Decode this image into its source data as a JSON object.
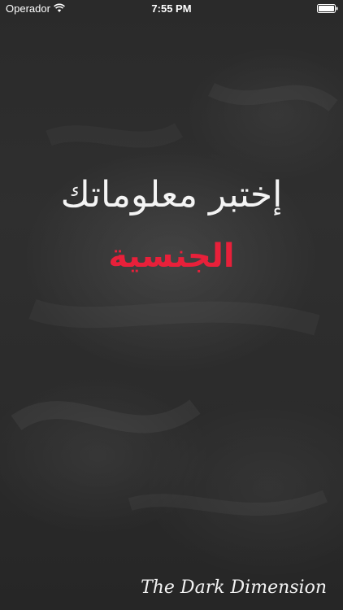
{
  "status_bar": {
    "carrier": "Operador",
    "time": "7:55 PM",
    "wifi_icon": "wifi-icon",
    "battery_icon": "battery-full-icon"
  },
  "screen": {
    "headline": "إختبر معلوماتك",
    "subheadline": "الجنسية",
    "brand": "The Dark Dimension"
  },
  "colors": {
    "background": "#2b2b2b",
    "headline": "#f4f4f4",
    "subheadline": "#e8203a"
  }
}
